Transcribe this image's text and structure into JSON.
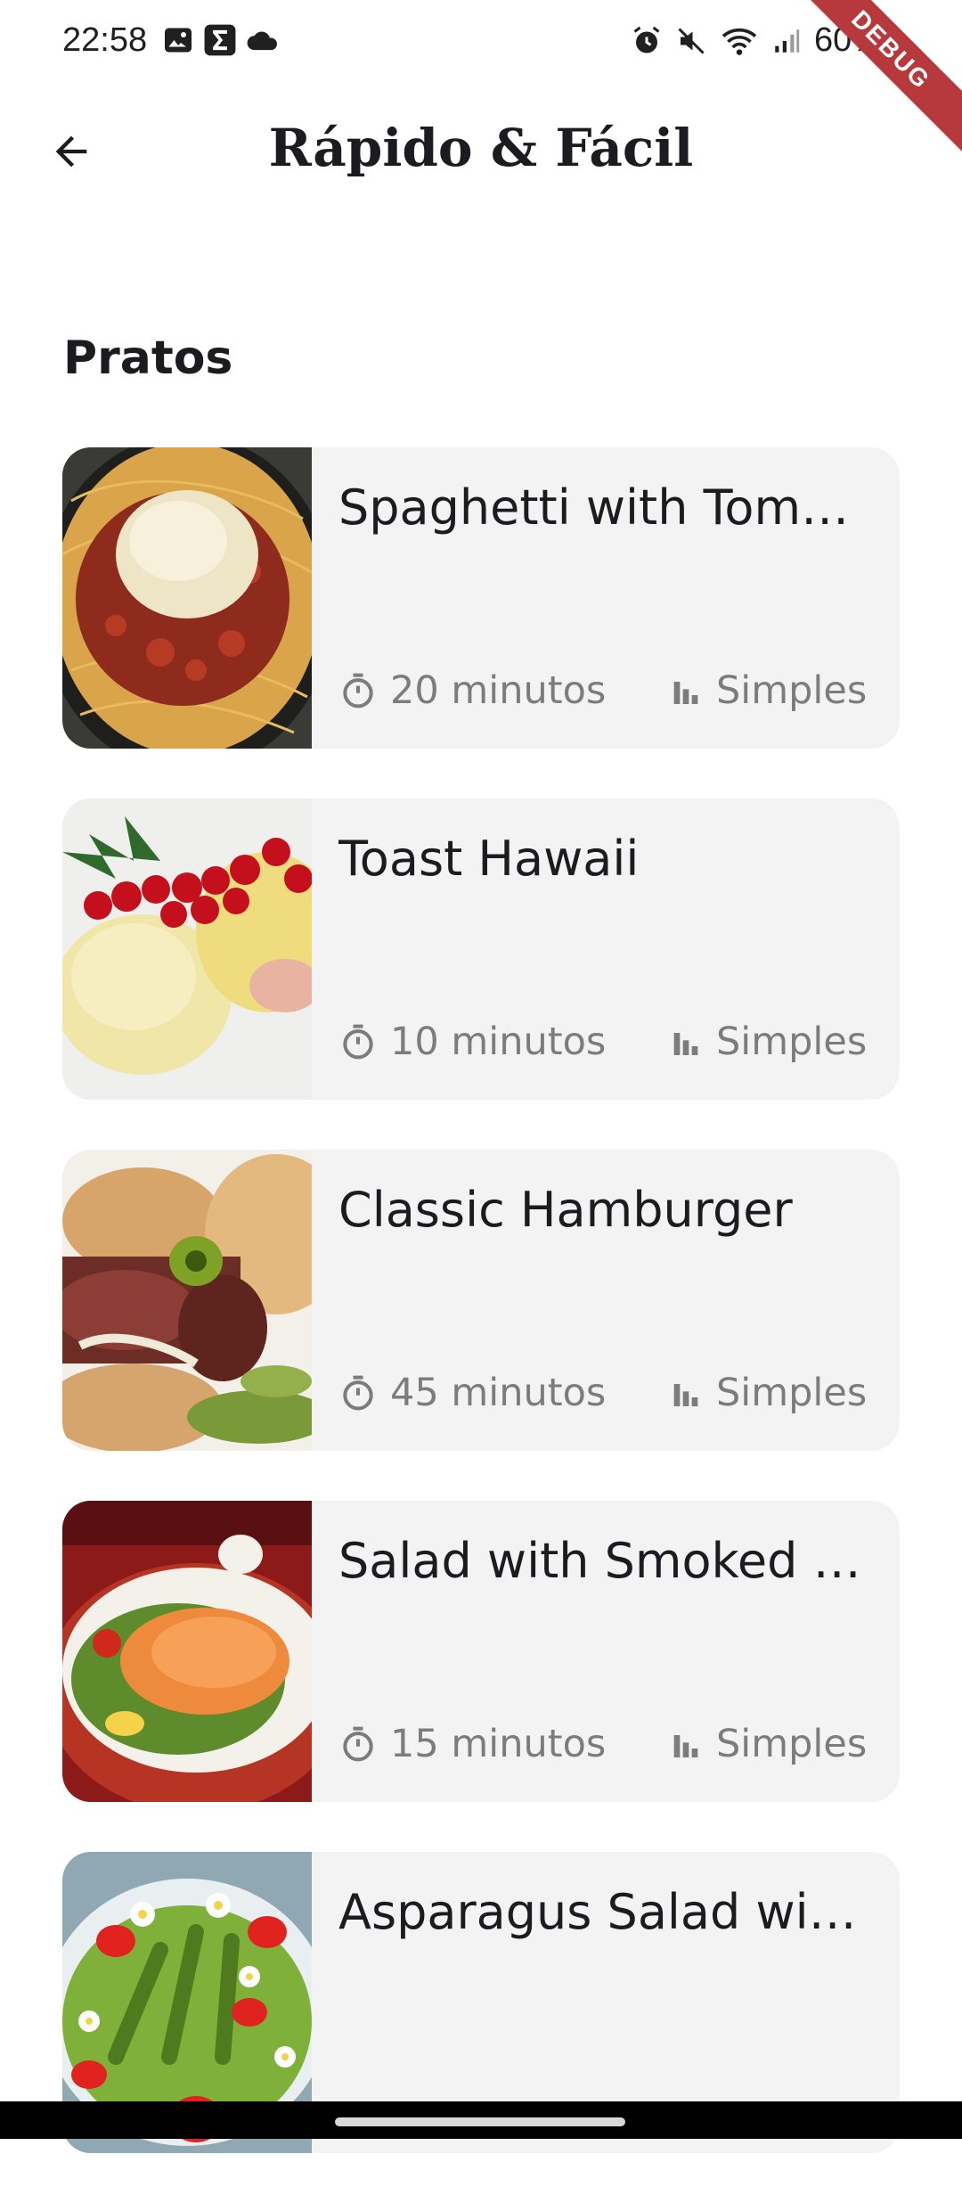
{
  "status_bar": {
    "time": "22:58",
    "left_icons": [
      "image-icon",
      "sigma-icon",
      "cloud-icon"
    ],
    "right_icons": [
      "alarm-icon",
      "mute-icon",
      "wifi-icon",
      "signal-icon"
    ],
    "battery": "60%"
  },
  "debug_banner": "DEBUG",
  "app_bar": {
    "title": "Rápido & Fácil",
    "back_icon": "arrow-back-icon"
  },
  "section": {
    "title": "Pratos"
  },
  "meals": [
    {
      "title": "Spaghetti with Tom…",
      "duration": "20 minutos",
      "complexity": "Simples",
      "image": "spaghetti"
    },
    {
      "title": "Toast Hawaii",
      "duration": "10 minutos",
      "complexity": "Simples",
      "image": "toast"
    },
    {
      "title": "Classic Hamburger",
      "duration": "45 minutos",
      "complexity": "Simples",
      "image": "hamburger"
    },
    {
      "title": "Salad with Smoked …",
      "duration": "15 minutos",
      "complexity": "Simples",
      "image": "salmon-salad"
    },
    {
      "title": "Asparagus Salad wi…",
      "duration": "",
      "complexity": "",
      "image": "asparagus-salad"
    }
  ],
  "colors": {
    "card_bg": "#f3f3f3",
    "meta_text": "#7c7c7c",
    "debug": "#b8393c"
  }
}
